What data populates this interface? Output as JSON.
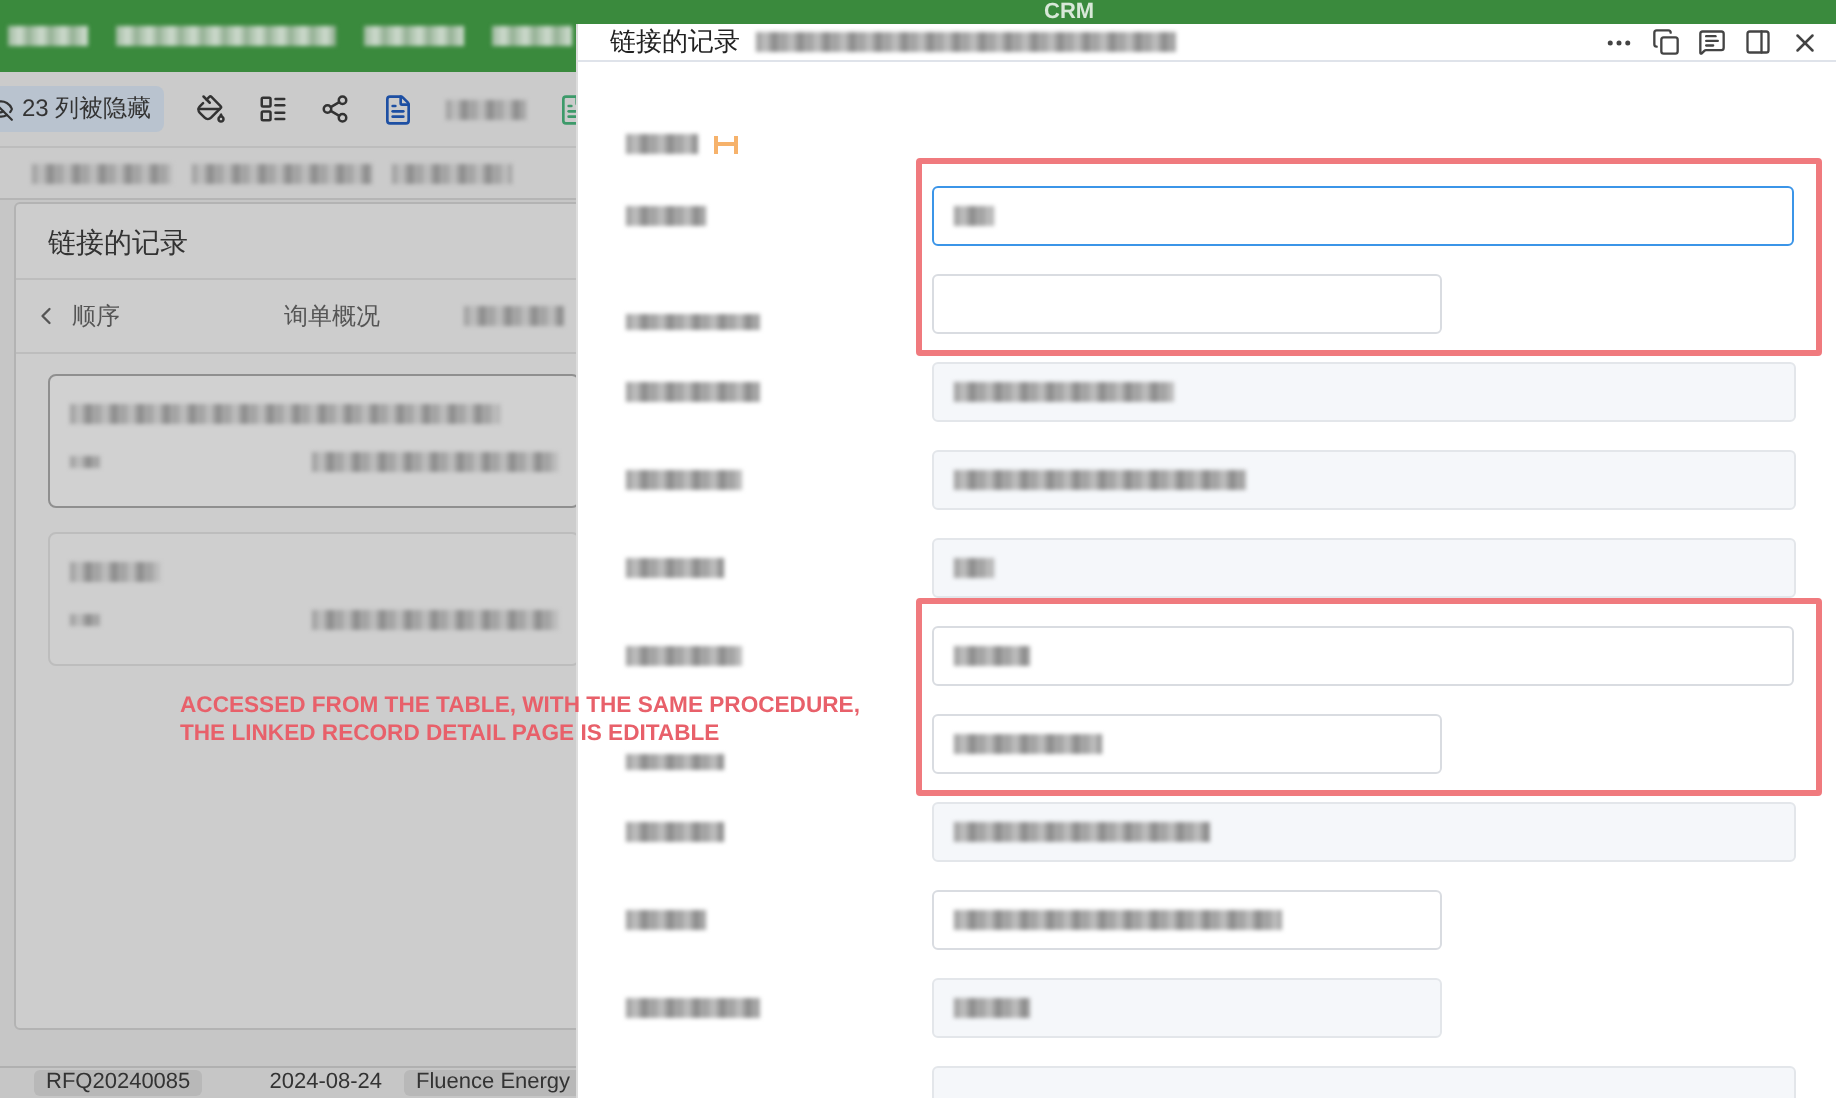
{
  "app": {
    "title": "CRM"
  },
  "toolbar": {
    "hidden_columns": "23 列被隐藏"
  },
  "table_row": {
    "cells": [
      "RFQ20240085",
      "2024-08-24",
      "Fluence Energy"
    ]
  },
  "linked_dialog": {
    "title": "链接的记录",
    "back_label": "顺序",
    "tab_label": "询单概况",
    "cards": [
      {
        "selected": true
      },
      {
        "selected": false
      }
    ]
  },
  "drawer": {
    "title": "链接的记录",
    "groups": [
      {
        "highlighted": true,
        "fields": [
          {
            "kind": "editable",
            "half": false,
            "focused": true,
            "filled": true
          },
          {
            "kind": "editable",
            "half": true,
            "focused": false,
            "filled": false
          }
        ]
      },
      {
        "highlighted": false,
        "fields": [
          {
            "kind": "readonly",
            "half": false,
            "focused": false,
            "filled": true
          },
          {
            "kind": "readonly",
            "half": false,
            "focused": false,
            "filled": true
          },
          {
            "kind": "readonly",
            "half": false,
            "focused": false,
            "filled": true
          }
        ]
      },
      {
        "highlighted": true,
        "fields": [
          {
            "kind": "editable",
            "half": false,
            "focused": false,
            "filled": true
          },
          {
            "kind": "editable",
            "half": true,
            "focused": false,
            "filled": true
          }
        ]
      },
      {
        "highlighted": false,
        "fields": [
          {
            "kind": "readonly",
            "half": false,
            "focused": false,
            "filled": true
          },
          {
            "kind": "editable",
            "half": true,
            "focused": false,
            "filled": true
          },
          {
            "kind": "readonly",
            "half": true,
            "focused": false,
            "filled": true
          },
          {
            "kind": "readonly",
            "half": false,
            "focused": false,
            "filled": false
          }
        ]
      }
    ]
  },
  "annotation": {
    "lines": [
      "ACCESSED FROM THE TABLE, WITH THE SAME PROCEDURE,",
      "THE LINKED RECORD DETAIL PAGE IS EDITABLE"
    ]
  }
}
